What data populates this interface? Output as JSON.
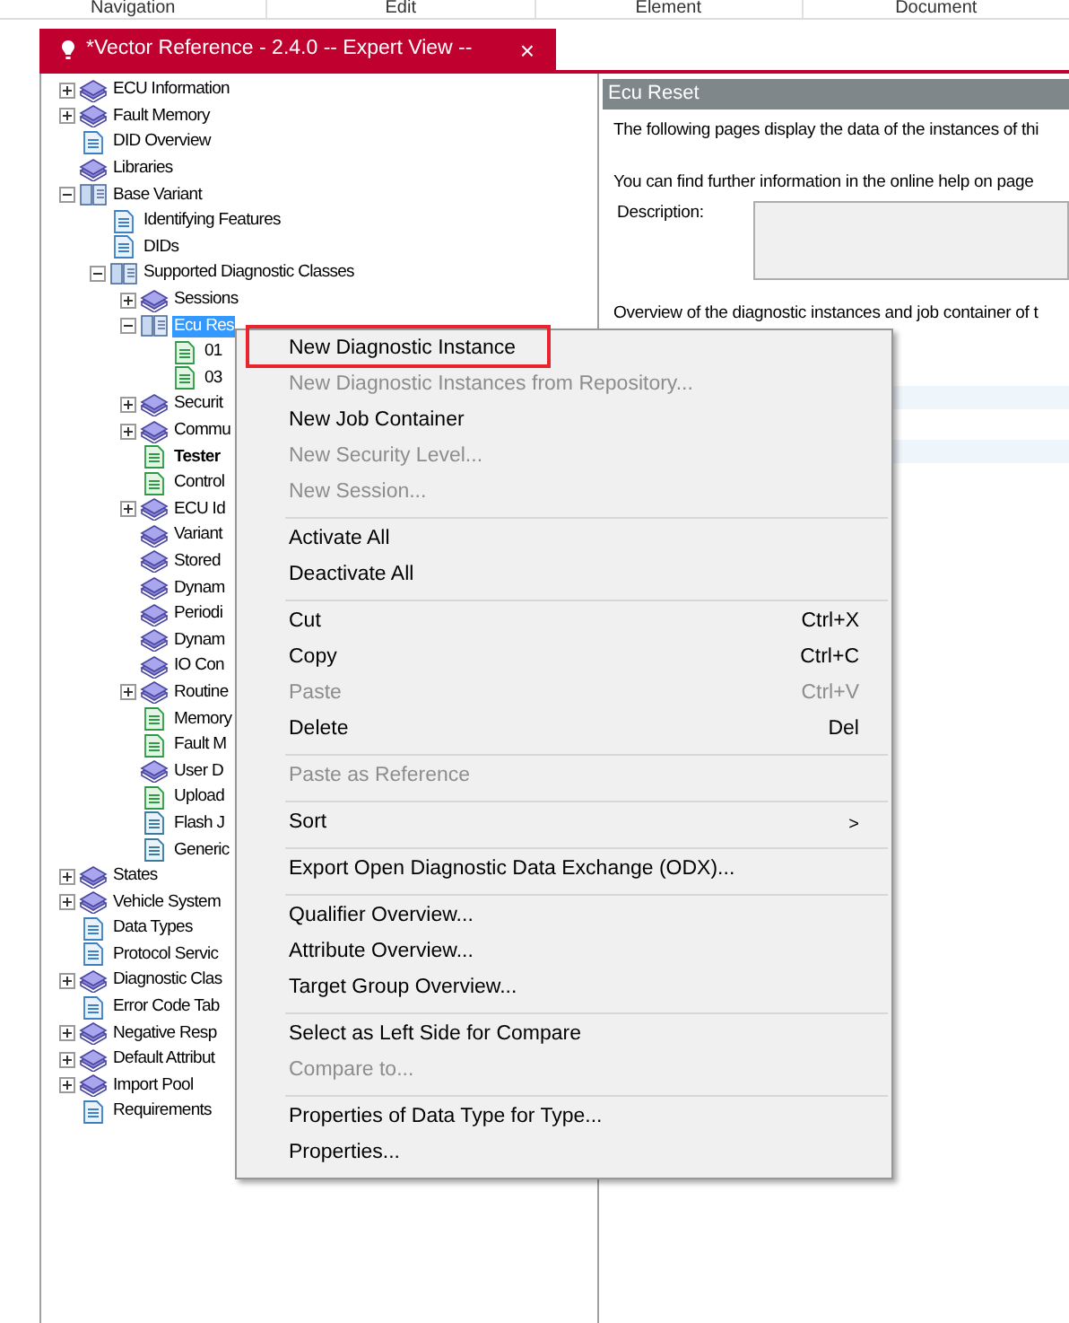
{
  "menu_bar": [
    "Navigation",
    "Edit",
    "Element",
    "Document"
  ],
  "tab": {
    "title": "*Vector Reference - 2.4.0 -- Expert View --",
    "close": "×"
  },
  "tree": [
    {
      "label": "ECU Information",
      "kind": "book",
      "expanded": false,
      "selected": false
    },
    {
      "label": "Fault Memory",
      "kind": "book",
      "expanded": false,
      "selected": false
    },
    {
      "label": "DID Overview",
      "kind": "doc",
      "selected": false
    },
    {
      "label": "Libraries",
      "kind": "book",
      "selected": false
    },
    {
      "label": "Base Variant",
      "kind": "openbook",
      "expanded": true,
      "selected": false,
      "children": [
        {
          "label": "Identifying Features",
          "kind": "doc",
          "selected": false
        },
        {
          "label": "DIDs",
          "kind": "doc",
          "selected": false
        },
        {
          "label": "Supported Diagnostic Classes",
          "kind": "openbook",
          "expanded": true,
          "selected": false,
          "children": [
            {
              "label": "Sessions",
              "kind": "book",
              "expanded": false,
              "selected": false
            },
            {
              "label": "Ecu Res",
              "kind": "openbook",
              "expanded": true,
              "selected": true,
              "children": [
                {
                  "label": "01",
                  "kind": "greendoc",
                  "selected": false
                },
                {
                  "label": "03",
                  "kind": "greendoc",
                  "selected": false
                }
              ]
            },
            {
              "label": "Securit",
              "kind": "book",
              "expanded": false,
              "selected": false
            },
            {
              "label": "Commu",
              "kind": "book",
              "expanded": false,
              "selected": false
            },
            {
              "label": "Tester",
              "kind": "greendoc",
              "bold": true,
              "selected": false
            },
            {
              "label": "Control",
              "kind": "greendoc",
              "selected": false
            },
            {
              "label": "ECU Id",
              "kind": "book",
              "expanded": false,
              "selected": false
            },
            {
              "label": "Variant",
              "kind": "book",
              "selected": false
            },
            {
              "label": "Stored",
              "kind": "book",
              "selected": false
            },
            {
              "label": "Dynam",
              "kind": "book",
              "selected": false
            },
            {
              "label": "Periodi",
              "kind": "book",
              "selected": false
            },
            {
              "label": "Dynam",
              "kind": "book",
              "selected": false
            },
            {
              "label": "IO Con",
              "kind": "book",
              "selected": false
            },
            {
              "label": "Routine",
              "kind": "book",
              "expanded": false,
              "selected": false
            },
            {
              "label": "Memory",
              "kind": "greendoc",
              "selected": false
            },
            {
              "label": "Fault M",
              "kind": "greendoc",
              "selected": false
            },
            {
              "label": "User D",
              "kind": "book",
              "selected": false
            },
            {
              "label": "Upload",
              "kind": "greendoc",
              "selected": false
            },
            {
              "label": "Flash J",
              "kind": "jobdoc",
              "selected": false
            },
            {
              "label": "Generic",
              "kind": "jobdoc",
              "selected": false
            }
          ]
        }
      ]
    },
    {
      "label": "States",
      "kind": "book",
      "expanded": false,
      "selected": false
    },
    {
      "label": "Vehicle System",
      "kind": "book",
      "expanded": false,
      "selected": false
    },
    {
      "label": "Data Types",
      "kind": "doc",
      "selected": false
    },
    {
      "label": "Protocol Servic",
      "kind": "doc",
      "selected": false
    },
    {
      "label": "Diagnostic Clas",
      "kind": "book",
      "expanded": false,
      "selected": false
    },
    {
      "label": "Error Code Tab",
      "kind": "doc",
      "selected": false
    },
    {
      "label": "Negative Resp",
      "kind": "book",
      "expanded": false,
      "selected": false
    },
    {
      "label": "Default Attribut",
      "kind": "book",
      "expanded": false,
      "selected": false
    },
    {
      "label": "Import Pool",
      "kind": "book",
      "expanded": false,
      "selected": false
    },
    {
      "label": "Requirements",
      "kind": "doc",
      "selected": false
    }
  ],
  "panel": {
    "title": "Ecu Reset",
    "intro": "The following pages display the data of the instances of thi",
    "help": "You can find further information in the online help on page",
    "description_label": "Description:",
    "overview": "Overview of the diagnostic instances and job container of t"
  },
  "context_menu": [
    {
      "kind": "item",
      "label": "New Diagnostic Instance",
      "disabled": false,
      "highlighted": true
    },
    {
      "kind": "item",
      "label": "New Diagnostic Instances from Repository...",
      "disabled": true,
      "highlighted": false
    },
    {
      "kind": "item",
      "label": "New Job Container",
      "disabled": false,
      "highlighted": false
    },
    {
      "kind": "item",
      "label": "New Security Level...",
      "disabled": true,
      "highlighted": false
    },
    {
      "kind": "item",
      "label": "New Session...",
      "disabled": true,
      "highlighted": false
    },
    {
      "kind": "separator"
    },
    {
      "kind": "item",
      "label": "Activate All",
      "disabled": false,
      "highlighted": false
    },
    {
      "kind": "item",
      "label": "Deactivate All",
      "disabled": false,
      "highlighted": false
    },
    {
      "kind": "separator"
    },
    {
      "kind": "item",
      "label": "Cut",
      "shortcut": "Ctrl+X",
      "disabled": false,
      "highlighted": false
    },
    {
      "kind": "item",
      "label": "Copy",
      "shortcut": "Ctrl+C",
      "disabled": false,
      "highlighted": false
    },
    {
      "kind": "item",
      "label": "Paste",
      "shortcut": "Ctrl+V",
      "disabled": true,
      "highlighted": false
    },
    {
      "kind": "item",
      "label": "Delete",
      "shortcut": "Del",
      "disabled": false,
      "highlighted": false
    },
    {
      "kind": "separator"
    },
    {
      "kind": "item",
      "label": "Paste as Reference",
      "disabled": true,
      "highlighted": false
    },
    {
      "kind": "separator"
    },
    {
      "kind": "item",
      "label": "Sort",
      "submenu": ">",
      "disabled": false,
      "highlighted": false
    },
    {
      "kind": "separator"
    },
    {
      "kind": "item",
      "label": "Export Open Diagnostic Data Exchange (ODX)...",
      "disabled": false,
      "highlighted": false
    },
    {
      "kind": "separator"
    },
    {
      "kind": "item",
      "label": "Qualifier Overview...",
      "disabled": false,
      "highlighted": false
    },
    {
      "kind": "item",
      "label": "Attribute Overview...",
      "disabled": false,
      "highlighted": false
    },
    {
      "kind": "item",
      "label": "Target Group Overview...",
      "disabled": false,
      "highlighted": false
    },
    {
      "kind": "separator"
    },
    {
      "kind": "item",
      "label": "Select as Left Side for Compare",
      "disabled": false,
      "highlighted": false
    },
    {
      "kind": "item",
      "label": "Compare to...",
      "disabled": true,
      "highlighted": false
    },
    {
      "kind": "separator"
    },
    {
      "kind": "item",
      "label": "Properties of Data Type for Type...",
      "disabled": false,
      "highlighted": false
    },
    {
      "kind": "item",
      "label": "Properties...",
      "disabled": false,
      "highlighted": false
    }
  ]
}
